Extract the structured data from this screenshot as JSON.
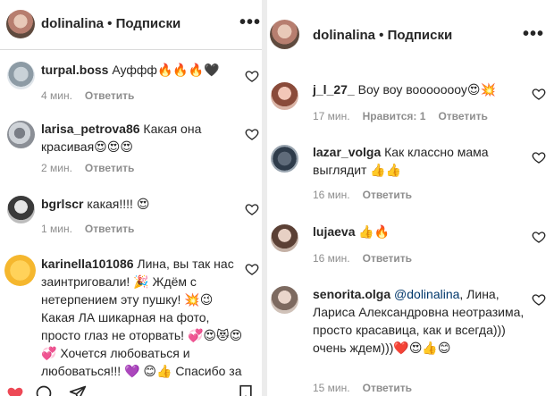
{
  "left": {
    "header": {
      "username": "dolinalina",
      "separator": " • ",
      "subscriptions": "Подписки",
      "more": "•••"
    },
    "comments": [
      {
        "user": "turpal.boss",
        "text": "Ауффф🔥🔥🔥🖤",
        "time": "4 мин.",
        "reply": "Ответить"
      },
      {
        "user": "larisa_petrova86",
        "text": "Какая она красивая😍😍😍",
        "time": "2 мин.",
        "reply": "Ответить"
      },
      {
        "user": "bgrlscr",
        "text": "какая!!!! 😍",
        "time": "1 мин.",
        "reply": "Ответить"
      },
      {
        "user": "karinella101086",
        "text": "Лина, вы так нас заинтриговали! 🎉 Ждём с нетерпением эту пушку! 💥😉 Какая ЛА шикарная на фото, просто глаз не оторвать! 💞😍😻😍 💞 Хочется любоваться и любоваться!!! 💜 😊👍 Спасибо за обалденное фото! 😘"
      }
    ]
  },
  "right": {
    "header": {
      "username": "dolinalina",
      "separator": " • ",
      "subscriptions": "Подписки",
      "more": "•••"
    },
    "comments": [
      {
        "user": "j_l_27_",
        "text": "Воу воу воооооооу😍💥",
        "time": "17 мин.",
        "likes": "Нравится: 1",
        "reply": "Ответить"
      },
      {
        "user": "lazar_volga",
        "text": "Как классно мама выглядит 👍👍",
        "time": "16 мин.",
        "reply": "Ответить"
      },
      {
        "user": "lujaeva",
        "text": "👍🔥",
        "time": "16 мин.",
        "reply": "Ответить"
      },
      {
        "user": "senorita.olga",
        "mention": "@dolinalina",
        "text": ", Лина, Лариса Александровна неотразима, просто красавица, как и всегда))) очень ждем)))❤️😍👍😊",
        "time": "15 мин.",
        "reply": "Ответить"
      }
    ]
  },
  "colors": {
    "text": "#262626",
    "muted": "#8e8e8e",
    "divider": "#dbdbdb",
    "mention": "#00376b",
    "liked": "#ed4956"
  },
  "icons": [
    "more-icon",
    "heart-icon",
    "comment-icon",
    "share-icon",
    "bookmark-icon"
  ]
}
